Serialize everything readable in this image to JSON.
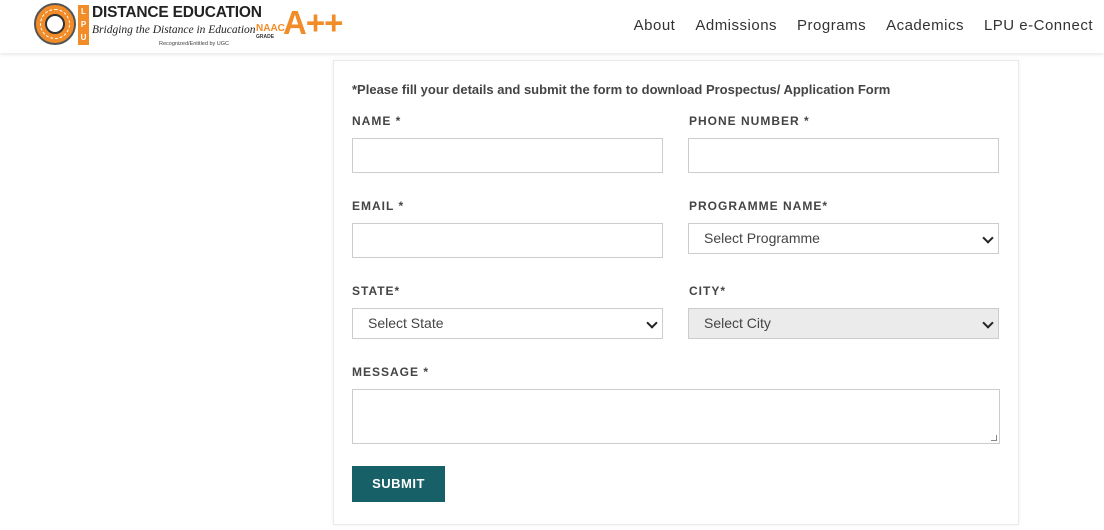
{
  "brand": {
    "lpu_letters": [
      "L",
      "P",
      "U"
    ],
    "title": "DISTANCE EDUCATION",
    "tagline": "Bridging the Distance in Education",
    "recognition": "Recognized/Entitled by UGC",
    "naac_word": "NAAC",
    "naac_grade": "GRADE",
    "naac_rating": "A++"
  },
  "nav": {
    "items": [
      "About",
      "Admissions",
      "Programs",
      "Academics",
      "LPU e-Connect"
    ]
  },
  "form": {
    "intro": "*Please fill your details and submit the form to download Prospectus/ Application Form",
    "name_label": "NAME *",
    "phone_label": "PHONE NUMBER *",
    "email_label": "EMAIL *",
    "programme_label": "PROGRAMME NAME*",
    "programme_selected": "Select Programme",
    "state_label": "STATE*",
    "state_selected": "Select State",
    "city_label": "CITY*",
    "city_selected": "Select City",
    "message_label": "MESSAGE *",
    "submit_label": "SUBMIT"
  },
  "colors": {
    "brand_orange": "#f28c28",
    "submit_teal": "#176068"
  }
}
